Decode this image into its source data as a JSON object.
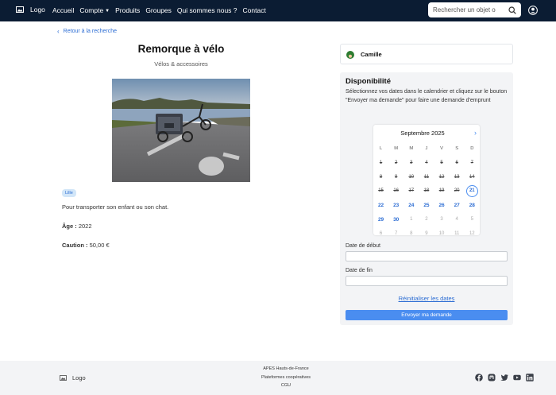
{
  "nav": {
    "logo": "Logo",
    "links": [
      "Accueil",
      "Compte",
      "Produits",
      "Groupes",
      "Qui sommes nous ?",
      "Contact"
    ],
    "search_placeholder": "Rechercher un objet o"
  },
  "back_link": "Retour à la recherche",
  "item": {
    "title": "Remorque à vélo",
    "category": "Vélos & accessoires",
    "badge": "Lille",
    "description": "Pour transporter son enfant ou son chat.",
    "age_label": "Âge :",
    "age_value": "2022",
    "caution_label": "Caution :",
    "caution_value": "50,00 €"
  },
  "owner": {
    "name": "Camille"
  },
  "availability": {
    "title": "Disponibilité",
    "instructions": "Sélectionnez vos dates dans le calendrier et cliquez sur le bouton \"Envoyer ma demande\" pour faire une demande d'emprunt",
    "month": "Septembre 2025",
    "weekdays": [
      "L",
      "M",
      "M",
      "J",
      "V",
      "S",
      "D"
    ],
    "days": [
      {
        "d": "1",
        "s": "past"
      },
      {
        "d": "2",
        "s": "past"
      },
      {
        "d": "3",
        "s": "past"
      },
      {
        "d": "4",
        "s": "past"
      },
      {
        "d": "5",
        "s": "past"
      },
      {
        "d": "6",
        "s": "past"
      },
      {
        "d": "7",
        "s": "past"
      },
      {
        "d": "8",
        "s": "past"
      },
      {
        "d": "9",
        "s": "past"
      },
      {
        "d": "10",
        "s": "past"
      },
      {
        "d": "11",
        "s": "past"
      },
      {
        "d": "12",
        "s": "past"
      },
      {
        "d": "13",
        "s": "past"
      },
      {
        "d": "14",
        "s": "past"
      },
      {
        "d": "15",
        "s": "past"
      },
      {
        "d": "16",
        "s": "past"
      },
      {
        "d": "17",
        "s": "past"
      },
      {
        "d": "18",
        "s": "past"
      },
      {
        "d": "19",
        "s": "past"
      },
      {
        "d": "20",
        "s": "past"
      },
      {
        "d": "21",
        "s": "today"
      },
      {
        "d": "22",
        "s": "avail"
      },
      {
        "d": "23",
        "s": "avail"
      },
      {
        "d": "24",
        "s": "avail"
      },
      {
        "d": "25",
        "s": "avail"
      },
      {
        "d": "26",
        "s": "avail"
      },
      {
        "d": "27",
        "s": "avail"
      },
      {
        "d": "28",
        "s": "avail"
      },
      {
        "d": "29",
        "s": "avail"
      },
      {
        "d": "30",
        "s": "avail"
      },
      {
        "d": "1",
        "s": "other"
      },
      {
        "d": "2",
        "s": "other"
      },
      {
        "d": "3",
        "s": "other"
      },
      {
        "d": "4",
        "s": "other"
      },
      {
        "d": "5",
        "s": "other"
      },
      {
        "d": "6",
        "s": "other"
      },
      {
        "d": "7",
        "s": "other"
      },
      {
        "d": "8",
        "s": "other"
      },
      {
        "d": "9",
        "s": "other"
      },
      {
        "d": "10",
        "s": "other"
      },
      {
        "d": "11",
        "s": "other"
      },
      {
        "d": "12",
        "s": "other"
      }
    ],
    "start_label": "Date de début",
    "end_label": "Date de fin",
    "reset": "Réinitialiser les dates",
    "send": "Envoyer ma demande"
  },
  "footer": {
    "logo": "Logo",
    "links": [
      "APES Hauts-de-France",
      "Plateformes coopératives",
      "CGU"
    ],
    "socials": [
      "facebook-icon",
      "mastodon-icon",
      "twitter-icon",
      "youtube-icon",
      "linkedin-icon"
    ]
  },
  "colors": {
    "navbar": "#0b1c33",
    "accent": "#4a8df0",
    "link": "#2b6cd3"
  }
}
